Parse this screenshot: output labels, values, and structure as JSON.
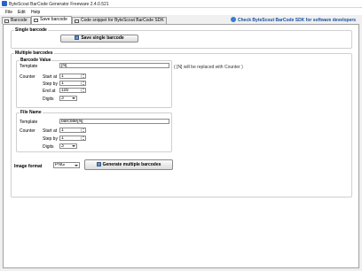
{
  "window": {
    "title": "ByteScout BarCode Generator Freeware 2.4.0.521"
  },
  "menu": [
    "File",
    "Edit",
    "Help"
  ],
  "tabs": [
    {
      "label": "Barcode"
    },
    {
      "label": "Save barcode"
    },
    {
      "label": "Code snippet for ByteScout BarCode SDK"
    }
  ],
  "sdk_link": "Check ByteScout BarCode SDK for software developers",
  "single": {
    "title": "Single barcode",
    "button": "Save single barcode"
  },
  "multiple": {
    "title": "Multiple barcodes",
    "value_group": {
      "title": "Barcode Value",
      "template_label": "Template",
      "template_value": "[N]",
      "hint": "( [N] will be replaced with Counter )",
      "counter_label": "Counter",
      "start_label": "Start at",
      "start_value": "1",
      "step_label": "Step by",
      "step_value": "1",
      "end_label": "End at",
      "end_value": "100",
      "digits_label": "Digits",
      "digits_value": "3"
    },
    "file_group": {
      "title": "File Name",
      "template_label": "Template",
      "template_value": "barcode[N]",
      "counter_label": "Counter",
      "start_label": "Start at",
      "start_value": "1",
      "step_label": "Step by",
      "step_value": "1",
      "digits_label": "Digits",
      "digits_value": "3"
    },
    "image_format_label": "Image format",
    "image_format_value": "PNG",
    "generate_button": "Generate multiple barcodes"
  }
}
